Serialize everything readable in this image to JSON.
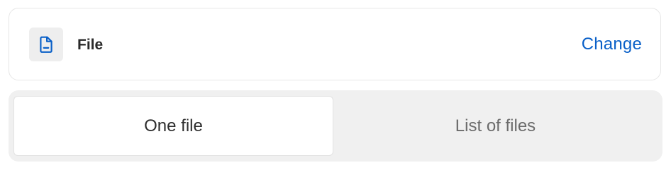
{
  "file_card": {
    "label": "File",
    "icon": "document-icon",
    "change_label": "Change",
    "accent_color": "#0a60c8"
  },
  "segmented_control": {
    "options": [
      {
        "label": "One file",
        "selected": true
      },
      {
        "label": "List of files",
        "selected": false
      }
    ]
  }
}
